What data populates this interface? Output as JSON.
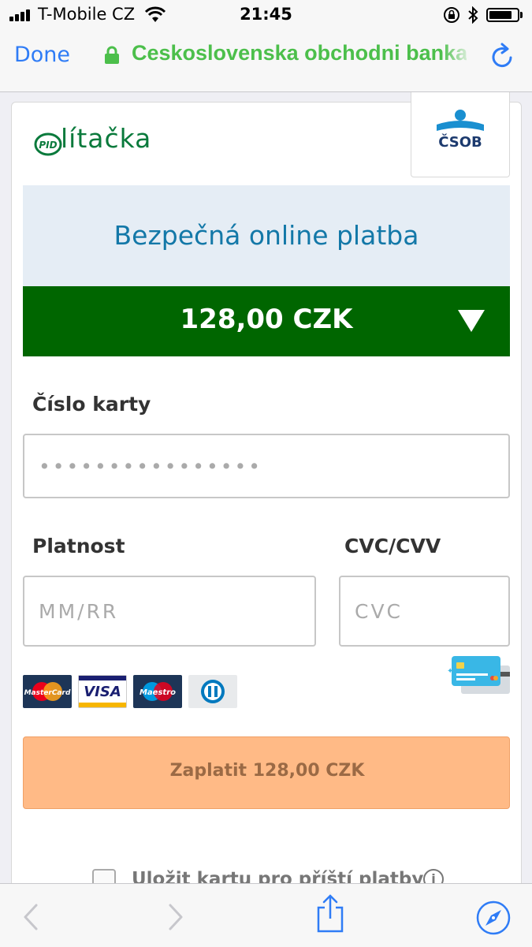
{
  "status_bar": {
    "carrier": "T-Mobile CZ",
    "time": "21:45",
    "icons": [
      "signal-icon",
      "wifi-icon",
      "rotation-lock-icon",
      "bluetooth-icon",
      "battery-icon"
    ]
  },
  "nav": {
    "done_label": "Done",
    "url": "Ceskoslovenska obchodni banka",
    "icons": [
      "lock-icon",
      "reload-icon"
    ]
  },
  "merchant": {
    "brand_name": "lítačka",
    "brand_badge": "PID",
    "bank_name": "ČSOB"
  },
  "payment": {
    "secure_title": "Bezpečná online platba",
    "amount": "128,00 CZK"
  },
  "form": {
    "card_number_label": "Číslo karty",
    "card_number_placeholder": "••••••••••••••••",
    "expiry_label": "Platnost",
    "expiry_placeholder": "MM/RR",
    "cvc_label": "CVC/CVV",
    "cvc_placeholder": "CVC"
  },
  "card_brands": [
    "MasterCard",
    "VISA",
    "Maestro",
    "Diners Club"
  ],
  "pay_button_label": "Zaplatit 128,00 CZK",
  "save_card_label": "Uložit kartu pro příští platby",
  "colors": {
    "link_blue": "#2f7cf6",
    "url_green": "#4cbf4b",
    "amount_bg": "#006600",
    "title_blue": "#1378a8",
    "pay_button": "#ffba86"
  },
  "toolbar": {
    "icons": [
      "back-icon",
      "forward-icon",
      "share-icon",
      "safari-compass-icon"
    ]
  }
}
